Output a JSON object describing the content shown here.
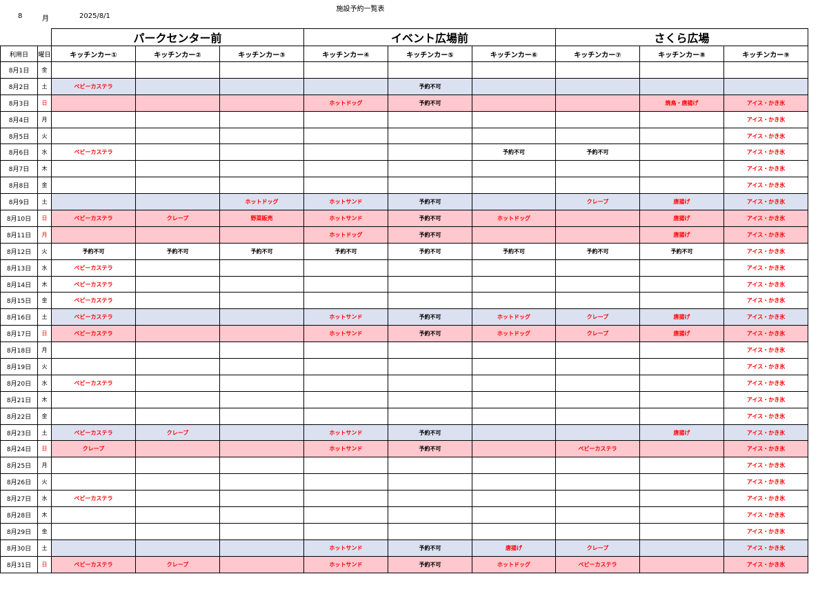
{
  "header": {
    "title": "施設予約一覧表",
    "month_number": "8",
    "month_char": "月",
    "date": "2025/8/1"
  },
  "areas": [
    "パークセンター前",
    "イベント広場前",
    "さくら広場"
  ],
  "columns": {
    "date": "利用日",
    "dow": "曜日",
    "cars": [
      "キッチンカー①",
      "キッチンカー②",
      "キッチンカー③",
      "キッチンカー④",
      "キッチンカー⑤",
      "キッチンカー⑥",
      "キッチンカー⑦",
      "キッチンカー⑧",
      "キッチンカー⑨"
    ]
  },
  "colors": {
    "saturday_bg": "#dbe1f1",
    "sunday_bg": "#ffc7ce",
    "weekday_bg": "#ffffff",
    "booking_text": "#ff0000",
    "unavailable_text": "#000000",
    "sunday_dow_text": "#ff0000"
  },
  "days": [
    {
      "date": "8月1日",
      "dow": "金",
      "type": "weekday",
      "cells": [
        "",
        "",
        "",
        "",
        "",
        "",
        "",
        "",
        ""
      ]
    },
    {
      "date": "8月2日",
      "dow": "土",
      "type": "saturday",
      "cells": [
        "ベビーカステラ",
        "",
        "",
        "",
        "予約不可",
        "",
        "",
        "",
        ""
      ]
    },
    {
      "date": "8月3日",
      "dow": "日",
      "type": "sunday",
      "cells": [
        "",
        "",
        "",
        "ホットドッグ",
        "予約不可",
        "",
        "",
        "焼鳥・唐揚げ",
        "アイス・かき氷"
      ]
    },
    {
      "date": "8月4日",
      "dow": "月",
      "type": "weekday",
      "cells": [
        "",
        "",
        "",
        "",
        "",
        "",
        "",
        "",
        "アイス・かき氷"
      ]
    },
    {
      "date": "8月5日",
      "dow": "火",
      "type": "weekday",
      "cells": [
        "",
        "",
        "",
        "",
        "",
        "",
        "",
        "",
        "アイス・かき氷"
      ]
    },
    {
      "date": "8月6日",
      "dow": "水",
      "type": "weekday",
      "cells": [
        "ベビーカステラ",
        "",
        "",
        "",
        "",
        "予約不可",
        "予約不可",
        "",
        "アイス・かき氷"
      ]
    },
    {
      "date": "8月7日",
      "dow": "木",
      "type": "weekday",
      "cells": [
        "",
        "",
        "",
        "",
        "",
        "",
        "",
        "",
        "アイス・かき氷"
      ]
    },
    {
      "date": "8月8日",
      "dow": "金",
      "type": "weekday",
      "cells": [
        "",
        "",
        "",
        "",
        "",
        "",
        "",
        "",
        "アイス・かき氷"
      ]
    },
    {
      "date": "8月9日",
      "dow": "土",
      "type": "saturday",
      "cells": [
        "",
        "",
        "ホットドッグ",
        "ホットサンド",
        "予約不可",
        "",
        "クレープ",
        "唐揚げ",
        "アイス・かき氷"
      ]
    },
    {
      "date": "8月10日",
      "dow": "日",
      "type": "sunday",
      "cells": [
        "ベビーカステラ",
        "クレープ",
        "野菜販売",
        "ホットサンド",
        "予約不可",
        "ホットドッグ",
        "",
        "唐揚げ",
        "アイス・かき氷"
      ]
    },
    {
      "date": "8月11日",
      "dow": "月",
      "type": "sunday",
      "cells": [
        "",
        "",
        "",
        "ホットドッグ",
        "予約不可",
        "",
        "",
        "唐揚げ",
        "アイス・かき氷"
      ]
    },
    {
      "date": "8月12日",
      "dow": "火",
      "type": "weekday",
      "cells": [
        "予約不可",
        "予約不可",
        "予約不可",
        "予約不可",
        "予約不可",
        "予約不可",
        "予約不可",
        "予約不可",
        "アイス・かき氷"
      ]
    },
    {
      "date": "8月13日",
      "dow": "水",
      "type": "weekday",
      "cells": [
        "ベビーカステラ",
        "",
        "",
        "",
        "",
        "",
        "",
        "",
        "アイス・かき氷"
      ]
    },
    {
      "date": "8月14日",
      "dow": "木",
      "type": "weekday",
      "cells": [
        "ベビーカステラ",
        "",
        "",
        "",
        "",
        "",
        "",
        "",
        "アイス・かき氷"
      ]
    },
    {
      "date": "8月15日",
      "dow": "金",
      "type": "weekday",
      "cells": [
        "ベビーカステラ",
        "",
        "",
        "",
        "",
        "",
        "",
        "",
        "アイス・かき氷"
      ]
    },
    {
      "date": "8月16日",
      "dow": "土",
      "type": "saturday",
      "cells": [
        "ベビーカステラ",
        "",
        "",
        "ホットサンド",
        "予約不可",
        "ホットドッグ",
        "クレープ",
        "唐揚げ",
        "アイス・かき氷"
      ]
    },
    {
      "date": "8月17日",
      "dow": "日",
      "type": "sunday",
      "cells": [
        "ベビーカステラ",
        "",
        "",
        "ホットサンド",
        "予約不可",
        "ホットドッグ",
        "クレープ",
        "唐揚げ",
        "アイス・かき氷"
      ]
    },
    {
      "date": "8月18日",
      "dow": "月",
      "type": "weekday",
      "cells": [
        "",
        "",
        "",
        "",
        "",
        "",
        "",
        "",
        "アイス・かき氷"
      ]
    },
    {
      "date": "8月19日",
      "dow": "火",
      "type": "weekday",
      "cells": [
        "",
        "",
        "",
        "",
        "",
        "",
        "",
        "",
        "アイス・かき氷"
      ]
    },
    {
      "date": "8月20日",
      "dow": "水",
      "type": "weekday",
      "cells": [
        "ベビーカステラ",
        "",
        "",
        "",
        "",
        "",
        "",
        "",
        "アイス・かき氷"
      ]
    },
    {
      "date": "8月21日",
      "dow": "木",
      "type": "weekday",
      "cells": [
        "",
        "",
        "",
        "",
        "",
        "",
        "",
        "",
        "アイス・かき氷"
      ]
    },
    {
      "date": "8月22日",
      "dow": "金",
      "type": "weekday",
      "cells": [
        "",
        "",
        "",
        "",
        "",
        "",
        "",
        "",
        "アイス・かき氷"
      ]
    },
    {
      "date": "8月23日",
      "dow": "土",
      "type": "saturday",
      "cells": [
        "ベビーカステラ",
        "クレープ",
        "",
        "ホットサンド",
        "予約不可",
        "",
        "",
        "唐揚げ",
        "アイス・かき氷"
      ]
    },
    {
      "date": "8月24日",
      "dow": "日",
      "type": "sunday",
      "cells": [
        "クレープ",
        "",
        "",
        "ホットサンド",
        "予約不可",
        "",
        "ベビーカステラ",
        "",
        "アイス・かき氷"
      ]
    },
    {
      "date": "8月25日",
      "dow": "月",
      "type": "weekday",
      "cells": [
        "",
        "",
        "",
        "",
        "",
        "",
        "",
        "",
        "アイス・かき氷"
      ]
    },
    {
      "date": "8月26日",
      "dow": "火",
      "type": "weekday",
      "cells": [
        "",
        "",
        "",
        "",
        "",
        "",
        "",
        "",
        "アイス・かき氷"
      ]
    },
    {
      "date": "8月27日",
      "dow": "水",
      "type": "weekday",
      "cells": [
        "ベビーカステラ",
        "",
        "",
        "",
        "",
        "",
        "",
        "",
        "アイス・かき氷"
      ]
    },
    {
      "date": "8月28日",
      "dow": "木",
      "type": "weekday",
      "cells": [
        "",
        "",
        "",
        "",
        "",
        "",
        "",
        "",
        "アイス・かき氷"
      ]
    },
    {
      "date": "8月29日",
      "dow": "金",
      "type": "weekday",
      "cells": [
        "",
        "",
        "",
        "",
        "",
        "",
        "",
        "",
        "アイス・かき氷"
      ]
    },
    {
      "date": "8月30日",
      "dow": "土",
      "type": "saturday",
      "cells": [
        "",
        "",
        "",
        "ホットサンド",
        "予約不可",
        "唐揚げ",
        "クレープ",
        "",
        "アイス・かき氷"
      ]
    },
    {
      "date": "8月31日",
      "dow": "日",
      "type": "sunday",
      "cells": [
        "ベビーカステラ",
        "クレープ",
        "",
        "ホットサンド",
        "予約不可",
        "ホットドッグ",
        "ベビーカステラ",
        "",
        "アイス・かき氷"
      ]
    }
  ]
}
